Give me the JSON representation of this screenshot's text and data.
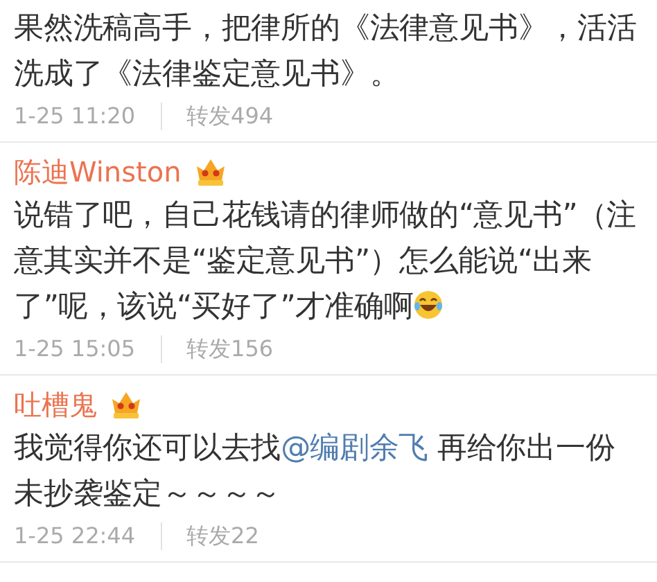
{
  "comments": [
    {
      "segments": [
        {
          "kind": "text",
          "text": "果然洗稿高手，把律所的《法律意见书》，活活洗成了《法律鉴定意见书》。"
        }
      ],
      "time": "1-25 11:20",
      "reposts": "转发494"
    },
    {
      "author": "陈迪Winston",
      "segments": [
        {
          "kind": "text",
          "text": "说错了吧，自己花钱请的律师做的“意见书”（注意其实并不是“鉴定意见书”）怎么能说“出来了”呢，该说“买好了”才准确啊"
        },
        {
          "kind": "emoji"
        }
      ],
      "time": "1-25 15:05",
      "reposts": "转发156"
    },
    {
      "author": "吐槽鬼",
      "segments": [
        {
          "kind": "text",
          "text": "我觉得你还可以去找"
        },
        {
          "kind": "mention",
          "text": "@编剧余飞"
        },
        {
          "kind": "text",
          "text": " 再给你出一份未抄袭鉴定～～～～"
        }
      ],
      "time": "1-25 22:44",
      "reposts": "转发22"
    }
  ]
}
